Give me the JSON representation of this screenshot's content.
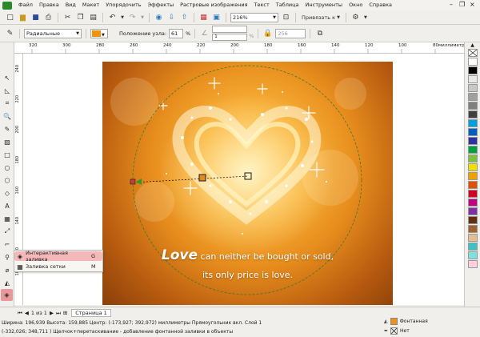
{
  "menu": [
    "Файл",
    "Правка",
    "Вид",
    "Макет",
    "Упорядочить",
    "Эффекты",
    "Растровые изображения",
    "Текст",
    "Таблица",
    "Инструменты",
    "Окно",
    "Справка"
  ],
  "toolbar": {
    "zoom": "216%",
    "snap": "Привязать к"
  },
  "property_bar": {
    "fill_type": "Радиальные",
    "node_position_label": "Положение узла:",
    "node_position_value": "61",
    "percent": "%",
    "value_one": "1",
    "value_256": "256"
  },
  "ruler": {
    "unit": "миллиметры",
    "ticks_h": [
      "320",
      "300",
      "280",
      "260",
      "240",
      "220",
      "200",
      "180",
      "160",
      "140",
      "120",
      "100",
      "80"
    ],
    "ticks_v": [
      "240",
      "220",
      "200",
      "180",
      "160",
      "140",
      "120",
      "100"
    ]
  },
  "artwork": {
    "quote_big": "Love",
    "quote_line1": " can neither be bought or sold,",
    "quote_line2": "its only price is love."
  },
  "flyout": {
    "item1": "Интерактивная заливка",
    "item1_key": "G",
    "item2": "Заливка сетки",
    "item2_key": "M"
  },
  "pages": {
    "counter": "1 из 1",
    "tab": "Страница 1"
  },
  "status": {
    "line1": "Ширина: 196,939  Высота: 159,885  Центр: (-173,927; 392,972)  миллиметры   Прямоугольник вкл. Слой 1",
    "line2": "(-332,026; 348,711 )   Щелчок+перетаскивание - добавление фонтанной заливки в объекты",
    "fill_label": "Фонтанная",
    "outline_label": "Нет"
  },
  "palette_colors": [
    "#ffffff",
    "#000000",
    "#e8e8e8",
    "#c8c8c8",
    "#a0a0a0",
    "#808080",
    "#404040",
    "#00a0e0",
    "#0060c0",
    "#3030a0",
    "#00a040",
    "#80c040",
    "#f0e000",
    "#f0a000",
    "#e05000",
    "#d00020",
    "#c00080",
    "#8030a0",
    "#603010",
    "#a06030",
    "#e0c090",
    "#40c0c0",
    "#80e0e0",
    "#ffd0e0"
  ]
}
